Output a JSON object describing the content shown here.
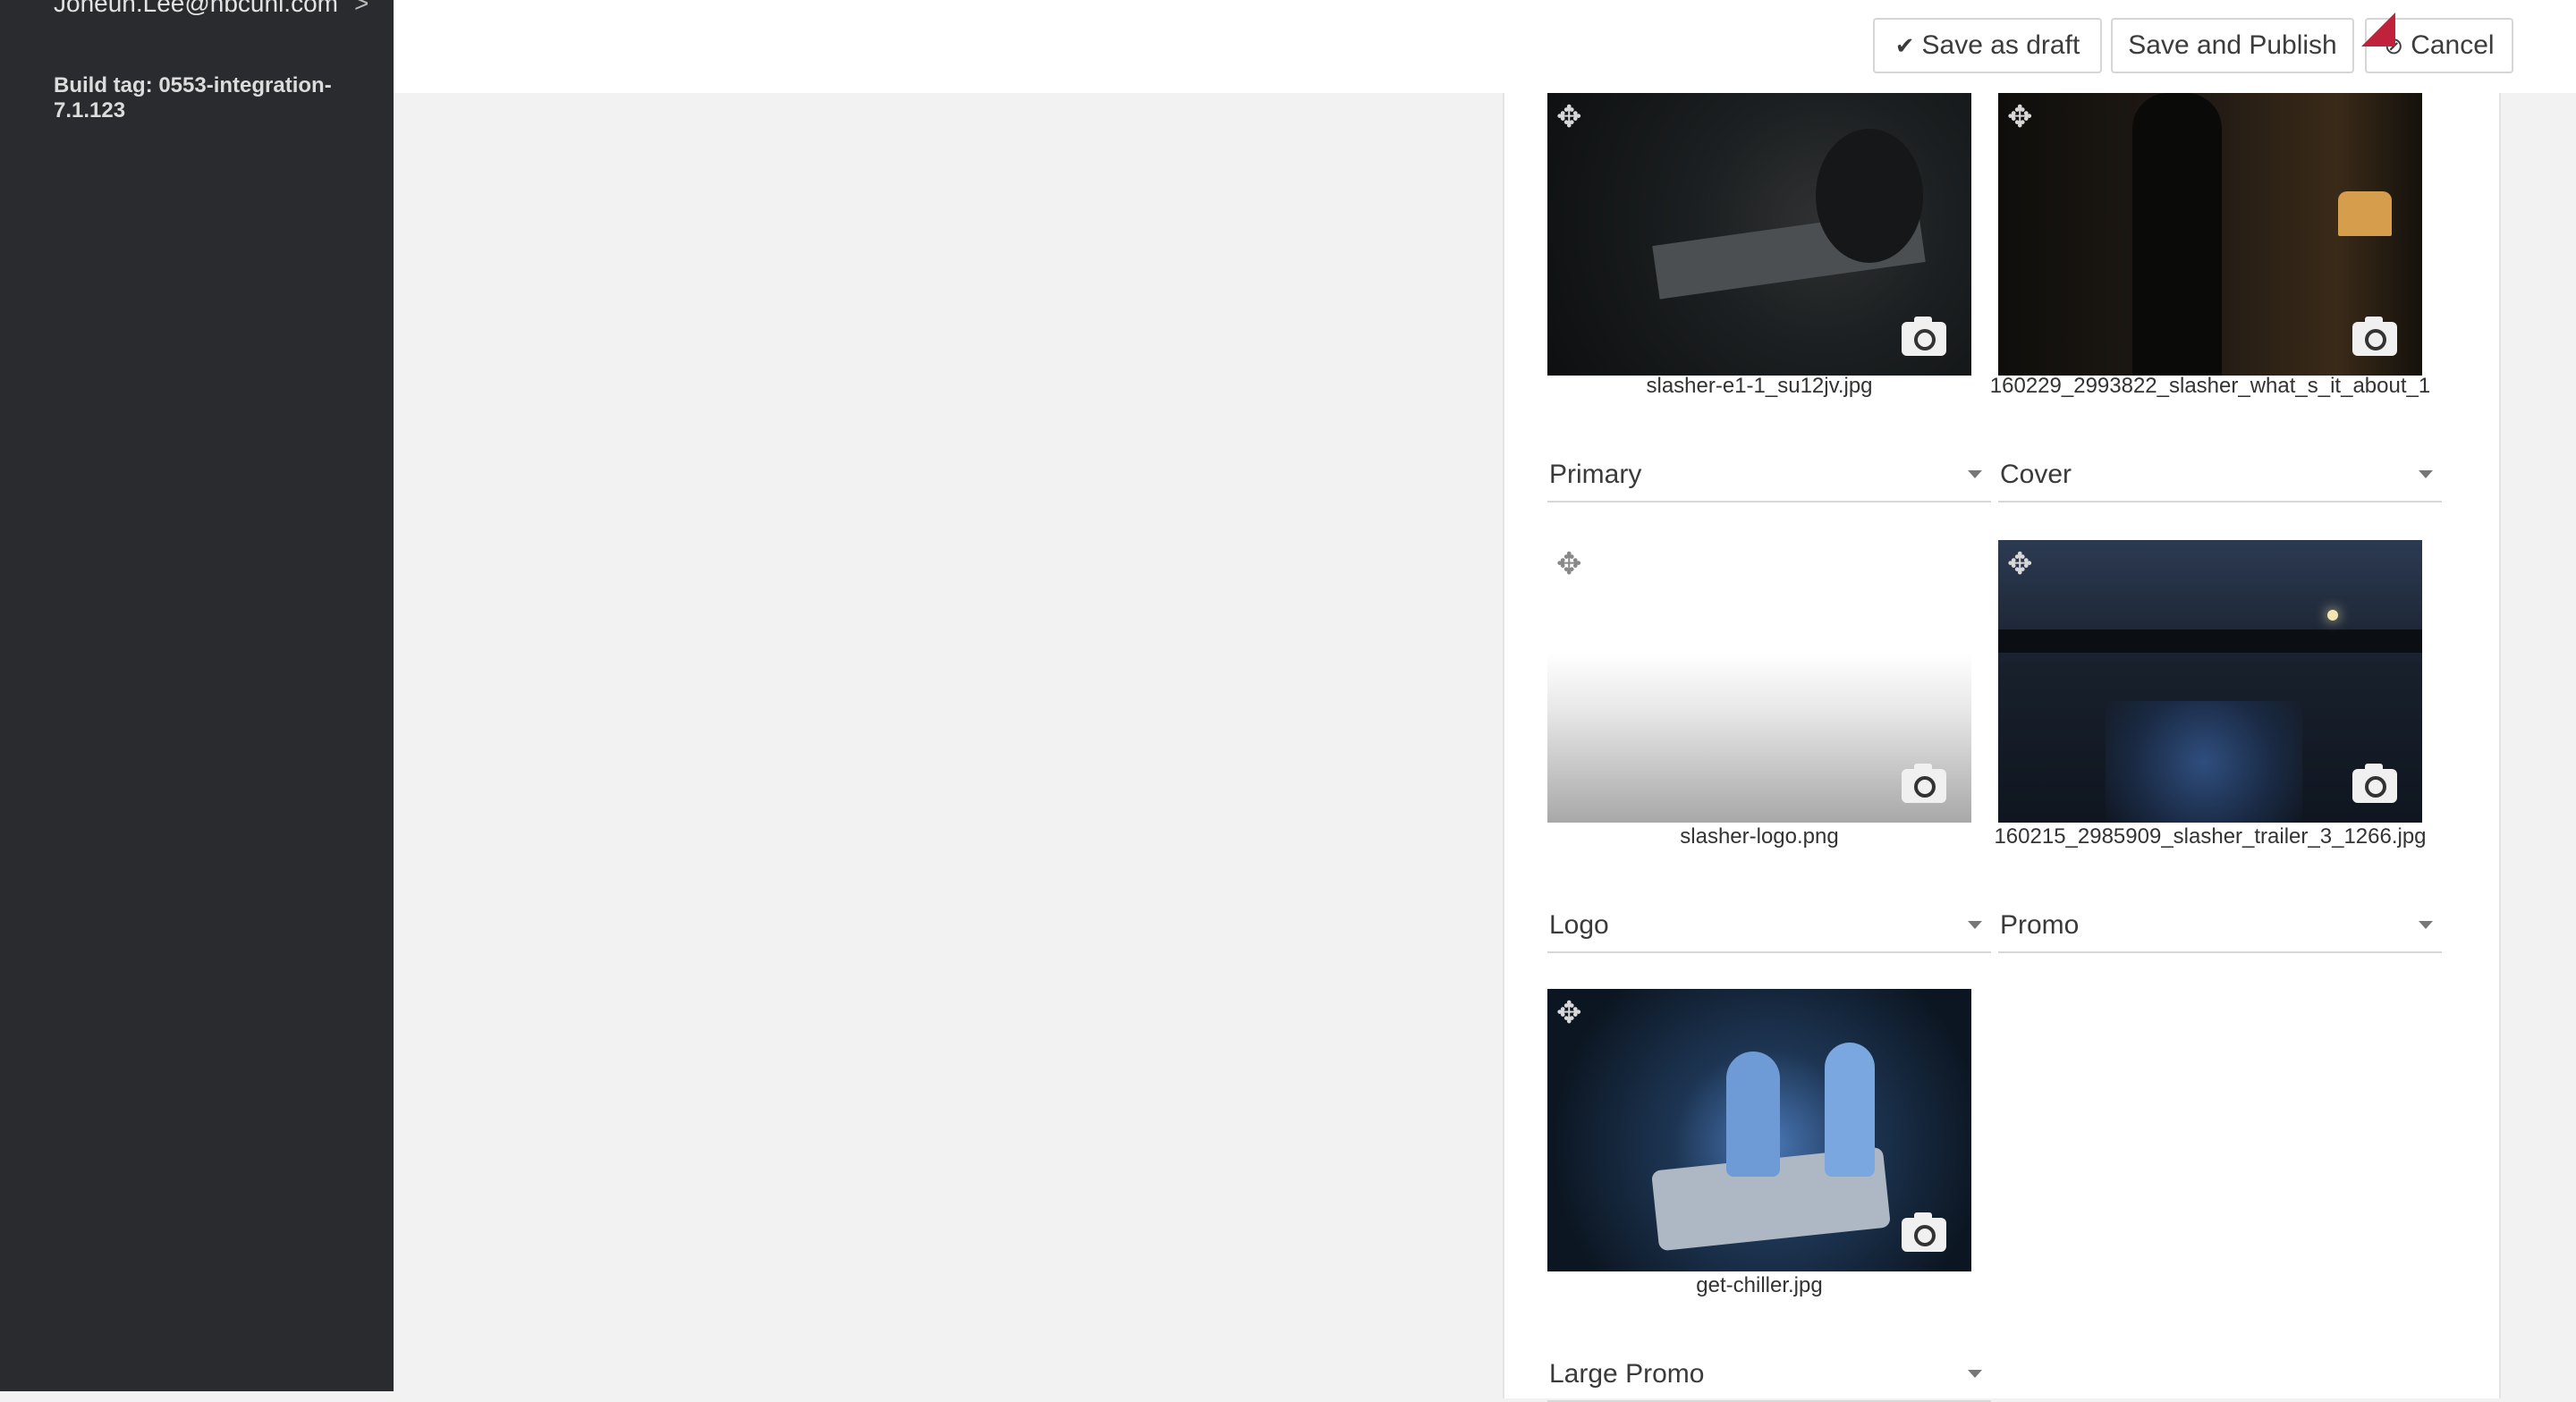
{
  "sidebar": {
    "user_email": "Joheun.Lee@nbcuni.com",
    "user_chevron": ">",
    "build_tag": "Build tag: 0553-integration-7.1.123"
  },
  "toolbar": {
    "save_draft_label": "Save as draft",
    "save_publish_label": "Save and Publish",
    "cancel_label": "Cancel",
    "check_icon": "✔",
    "cancel_icon": "⊘"
  },
  "images": [
    {
      "filename": "slasher-e1-1_su12jv.jpg",
      "role": "Primary"
    },
    {
      "filename": "160229_2993822_slasher_what_s_it_about_1",
      "role": "Cover"
    },
    {
      "filename": "slasher-logo.png",
      "role": "Logo"
    },
    {
      "filename": "160215_2985909_slasher_trailer_3_1266.jpg",
      "role": "Promo"
    },
    {
      "filename": "get-chiller.jpg",
      "role": "Large Promo"
    }
  ],
  "icons": {
    "move": "✥"
  },
  "colors": {
    "sidebar_bg": "#2a2b2e",
    "accent_flag": "#c0223b"
  }
}
